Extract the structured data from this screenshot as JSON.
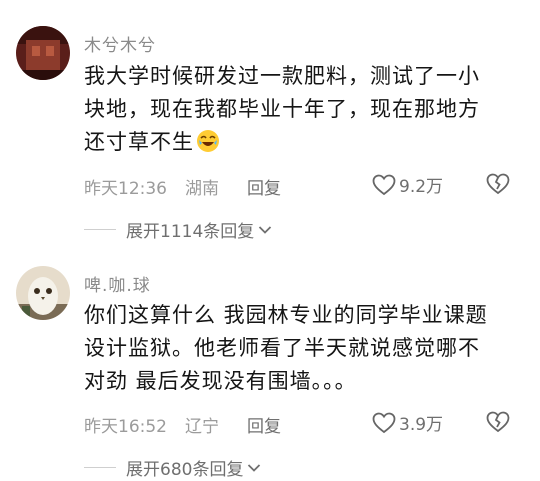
{
  "comments": [
    {
      "username": "木兮木兮",
      "lines": [
        "我大学时候研发过一款肥料，测试了一小",
        "块地，现在我都毕业十年了，现在那地方",
        "还寸草不生"
      ],
      "emoji": "laughing-face-icon",
      "time": "昨天12:36",
      "region": "湖南",
      "reply_label": "回复",
      "likes": "9.2万",
      "expand_label": "展开1114条回复"
    },
    {
      "username": "啤.咖.球",
      "lines": [
        "你们这算什么 我园林专业的同学毕业课题",
        "设计监狱。他老师看了半天就说感觉哪不",
        "对劲 最后发现没有围墙。。。"
      ],
      "time": "昨天16:52",
      "region": "辽宁",
      "reply_label": "回复",
      "likes": "3.9万",
      "expand_label": "展开680条回复"
    }
  ],
  "colors": {
    "text": "#151515",
    "meta": "#9b9b9b",
    "action": "#6f6f6f",
    "divider": "#cfcfcf"
  }
}
